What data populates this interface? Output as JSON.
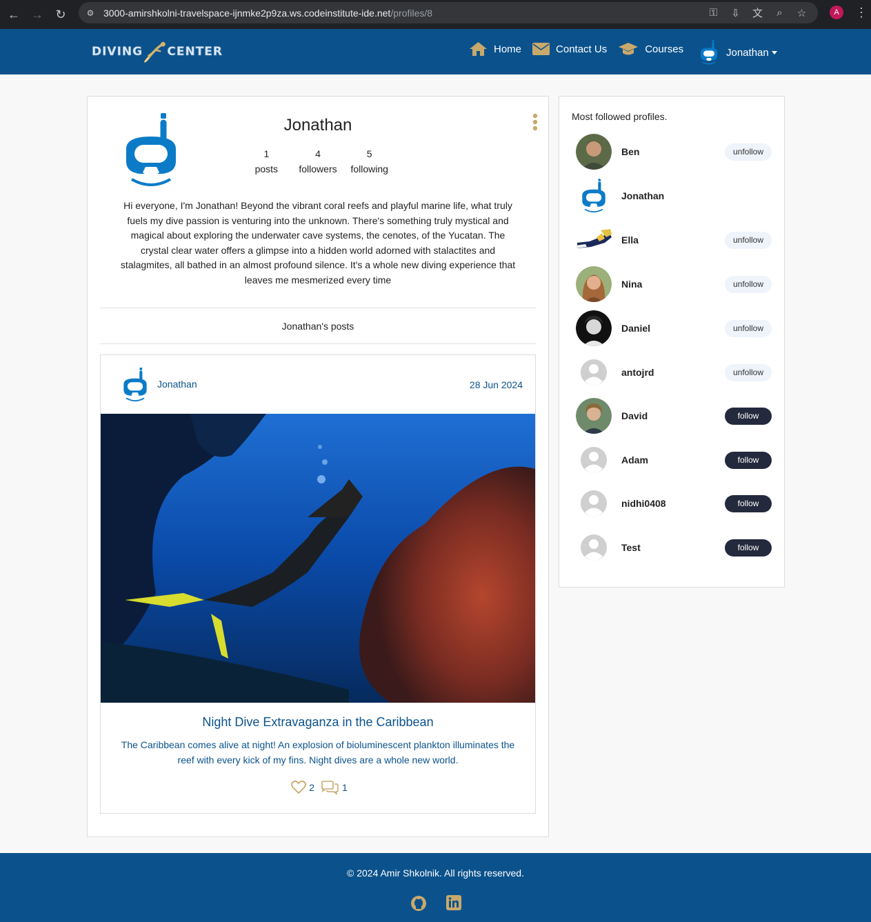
{
  "browser": {
    "url_host": "3000-amirshkolni-travelspace-ijnmke2p9za.ws.codeinstitute-ide.net",
    "url_path": "/profiles/8",
    "profile_initial": "A"
  },
  "navbar": {
    "logo_left": "DIVING",
    "logo_right": "CENTER",
    "links": [
      {
        "label": "Home",
        "icon": "home-icon"
      },
      {
        "label": "Contact Us",
        "icon": "envelope-icon"
      },
      {
        "label": "Courses",
        "icon": "graduation-cap-icon"
      }
    ],
    "user_label": "Jonathan"
  },
  "profile": {
    "name": "Jonathan",
    "stats": [
      {
        "value": "1",
        "label": "posts"
      },
      {
        "value": "4",
        "label": "followers"
      },
      {
        "value": "5",
        "label": "following"
      }
    ],
    "bio": "Hi everyone, I'm Jonathan! Beyond the vibrant coral reefs and playful marine life, what truly fuels my dive passion is venturing into the unknown. There's something truly mystical and magical about exploring the underwater cave systems, the cenotes, of the Yucatan. The crystal clear water offers a glimpse into a hidden world adorned with stalactites and stalagmites, all bathed in an almost profound silence. It's a whole new diving experience that leaves me mesmerized every time",
    "posts_heading": "Jonathan's posts"
  },
  "post": {
    "author": "Jonathan",
    "date": "28 Jun 2024",
    "title": "Night Dive Extravaganza in the Caribbean",
    "text": "The Caribbean comes alive at night! An explosion of bioluminescent plankton illuminates the reef with every kick of my fins. Night dives are a whole new world.",
    "likes": "2",
    "comments": "1"
  },
  "sidebar": {
    "title": "Most followed profiles.",
    "profiles": [
      {
        "name": "Ben",
        "button": "unfollow",
        "avatar": "photo"
      },
      {
        "name": "Jonathan",
        "button": "",
        "avatar": "mask"
      },
      {
        "name": "Ella",
        "button": "unfollow",
        "avatar": "diver"
      },
      {
        "name": "Nina",
        "button": "unfollow",
        "avatar": "photo"
      },
      {
        "name": "Daniel",
        "button": "unfollow",
        "avatar": "photo"
      },
      {
        "name": "antojrd",
        "button": "unfollow",
        "avatar": "default"
      },
      {
        "name": "David",
        "button": "follow",
        "avatar": "photo"
      },
      {
        "name": "Adam",
        "button": "follow",
        "avatar": "default"
      },
      {
        "name": "nidhi0408",
        "button": "follow",
        "avatar": "default"
      },
      {
        "name": "Test",
        "button": "follow",
        "avatar": "default"
      }
    ]
  },
  "footer": {
    "copyright": "© 2024 Amir Shkolnik. All rights reserved.",
    "icons": [
      "github-icon",
      "linkedin-icon"
    ]
  },
  "colors": {
    "brand_blue": "#0b528c",
    "accent_gold": "#c9a96b",
    "follow_dark": "#242a3d"
  }
}
